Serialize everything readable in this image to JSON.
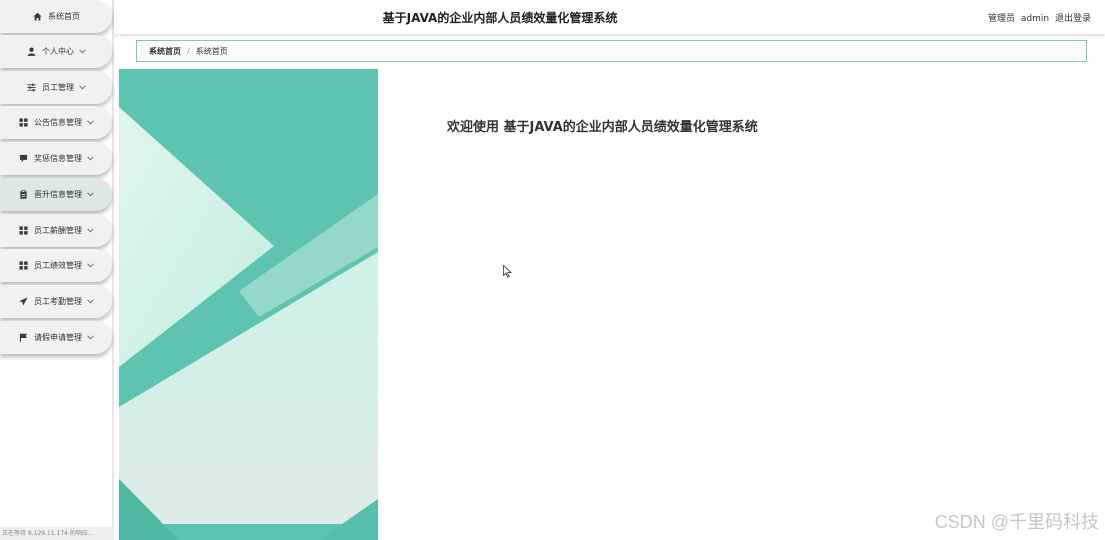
{
  "header": {
    "title": "基于JAVA的企业内部人员绩效量化管理系统",
    "role_label": "管理员",
    "username": "admin",
    "logout_label": "退出登录"
  },
  "sidebar": {
    "items": [
      {
        "label": "系统首页",
        "icon": "home-icon",
        "has_chevron": false
      },
      {
        "label": "个人中心",
        "icon": "user-icon",
        "has_chevron": true
      },
      {
        "label": "员工管理",
        "icon": "sliders-icon",
        "has_chevron": true
      },
      {
        "label": "公告信息管理",
        "icon": "grid-icon",
        "has_chevron": true
      },
      {
        "label": "奖惩信息管理",
        "icon": "comment-icon",
        "has_chevron": true
      },
      {
        "label": "晋升信息管理",
        "icon": "clipboard-icon",
        "has_chevron": true,
        "active": true
      },
      {
        "label": "员工薪酬管理",
        "icon": "grid-icon",
        "has_chevron": true
      },
      {
        "label": "员工绩效管理",
        "icon": "grid-icon",
        "has_chevron": true
      },
      {
        "label": "员工考勤管理",
        "icon": "send-icon",
        "has_chevron": true
      },
      {
        "label": "请假申请管理",
        "icon": "flag-icon",
        "has_chevron": true
      }
    ]
  },
  "breadcrumb": {
    "items": [
      "系统首页",
      "系统首页"
    ],
    "separator": "/"
  },
  "main": {
    "welcome_text": "欢迎使用 基于JAVA的企业内部人员绩效量化管理系统"
  },
  "statusbar": {
    "text": "正在等待 8.129.11.174 的响应..."
  },
  "watermark": "CSDN @千里码科技",
  "colors": {
    "accent": "#5ec4b0",
    "hero_light": "#dff6ee",
    "sidebar_item_bg": "#f1f1f1"
  }
}
